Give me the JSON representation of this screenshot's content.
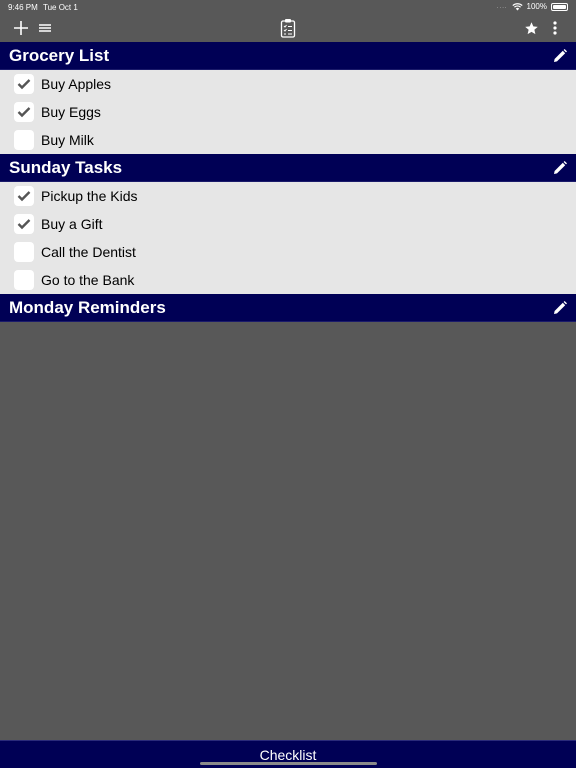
{
  "status_bar": {
    "time": "9:46 PM",
    "date": "Tue Oct 1",
    "signal_dots": "....",
    "battery": "100%"
  },
  "toolbar": {
    "add_icon": "plus-icon",
    "menu_icon": "hamburger-icon",
    "center_icon": "clipboard-checklist-icon",
    "favorite_icon": "star-icon",
    "more_icon": "vertical-ellipsis-icon"
  },
  "lists": [
    {
      "title": "Grocery List",
      "items": [
        {
          "label": "Buy Apples",
          "checked": true
        },
        {
          "label": "Buy Eggs",
          "checked": true
        },
        {
          "label": "Buy Milk",
          "checked": false
        }
      ]
    },
    {
      "title": "Sunday Tasks",
      "items": [
        {
          "label": "Pickup the Kids",
          "checked": true
        },
        {
          "label": "Buy a Gift",
          "checked": true
        },
        {
          "label": "Call the Dentist",
          "checked": false
        },
        {
          "label": "Go to the Bank",
          "checked": false
        }
      ]
    },
    {
      "title": "Monday Reminders",
      "items": []
    }
  ],
  "bottom_bar": {
    "title": "Checklist"
  },
  "colors": {
    "header_bg": "#000055",
    "page_bg": "#585858",
    "row_bg": "#e6e6e6"
  }
}
